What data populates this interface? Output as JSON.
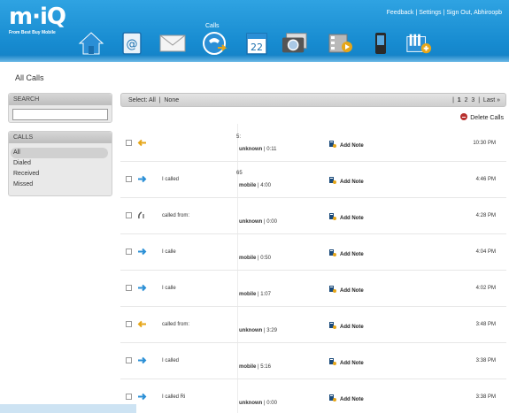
{
  "brand": {
    "logo_text": "m·iQ",
    "tagline": "From Best Buy Mobile"
  },
  "top_links": {
    "feedback": "Feedback",
    "settings": "Settings",
    "sign_out": "Sign Out, Abhiroopb"
  },
  "nav": {
    "active_label": "Calls",
    "items": [
      {
        "name": "home-icon"
      },
      {
        "name": "contacts-icon"
      },
      {
        "name": "messages-icon"
      },
      {
        "name": "calls-icon"
      },
      {
        "name": "calendar-icon",
        "day": "22"
      },
      {
        "name": "photos-icon"
      },
      {
        "name": "videos-icon"
      },
      {
        "name": "phone-icon"
      },
      {
        "name": "groups-icon"
      }
    ]
  },
  "page": {
    "title": "All Calls"
  },
  "search": {
    "title": "SEARCH",
    "placeholder": ""
  },
  "calls_panel": {
    "title": "CALLS",
    "items": [
      {
        "label": "All",
        "active": true
      },
      {
        "label": "Dialed",
        "active": false
      },
      {
        "label": "Received",
        "active": false
      },
      {
        "label": "Missed",
        "active": false
      }
    ]
  },
  "toolbar": {
    "select_label": "Select:",
    "all": "All",
    "none": "None",
    "pages": [
      "1",
      "2",
      "3"
    ],
    "current_page": "1",
    "last": "Last »",
    "delete_calls": "Delete Calls"
  },
  "colors": {
    "header": "#178bd0",
    "received_arrow": "#e6a619",
    "dialed_arrow": "#2b8fd6",
    "missed_icon": "#555555"
  },
  "rows": [
    {
      "direction": "received",
      "desc": "",
      "line1": "5:",
      "type": "unknown",
      "duration": "0:11",
      "note": "Add Note",
      "time": "10:30 PM"
    },
    {
      "direction": "dialed",
      "desc": "I called",
      "line1": "65",
      "type": "mobile",
      "duration": "4:00",
      "note": "Add Note",
      "time": "4:46 PM"
    },
    {
      "direction": "missed",
      "desc": "called from:",
      "line1": "",
      "type": "unknown",
      "duration": "0:00",
      "note": "Add Note",
      "time": "4:28 PM"
    },
    {
      "direction": "dialed",
      "desc": "I calle",
      "line1": "",
      "type": "mobile",
      "duration": "0:50",
      "note": "Add Note",
      "time": "4:04 PM"
    },
    {
      "direction": "dialed",
      "desc": "I calle",
      "line1": "",
      "type": "mobile",
      "duration": "1:07",
      "note": "Add Note",
      "time": "4:02 PM"
    },
    {
      "direction": "received",
      "desc": "called from:",
      "line1": "",
      "type": "unknown",
      "duration": "3:29",
      "note": "Add Note",
      "time": "3:48 PM"
    },
    {
      "direction": "dialed",
      "desc": "I called",
      "line1": "",
      "type": "mobile",
      "duration": "5:16",
      "note": "Add Note",
      "time": "3:38 PM"
    },
    {
      "direction": "dialed",
      "desc": "I called Ri",
      "line1": "",
      "type": "unknown",
      "duration": "0:00",
      "note": "Add Note",
      "time": "3:38 PM"
    }
  ]
}
